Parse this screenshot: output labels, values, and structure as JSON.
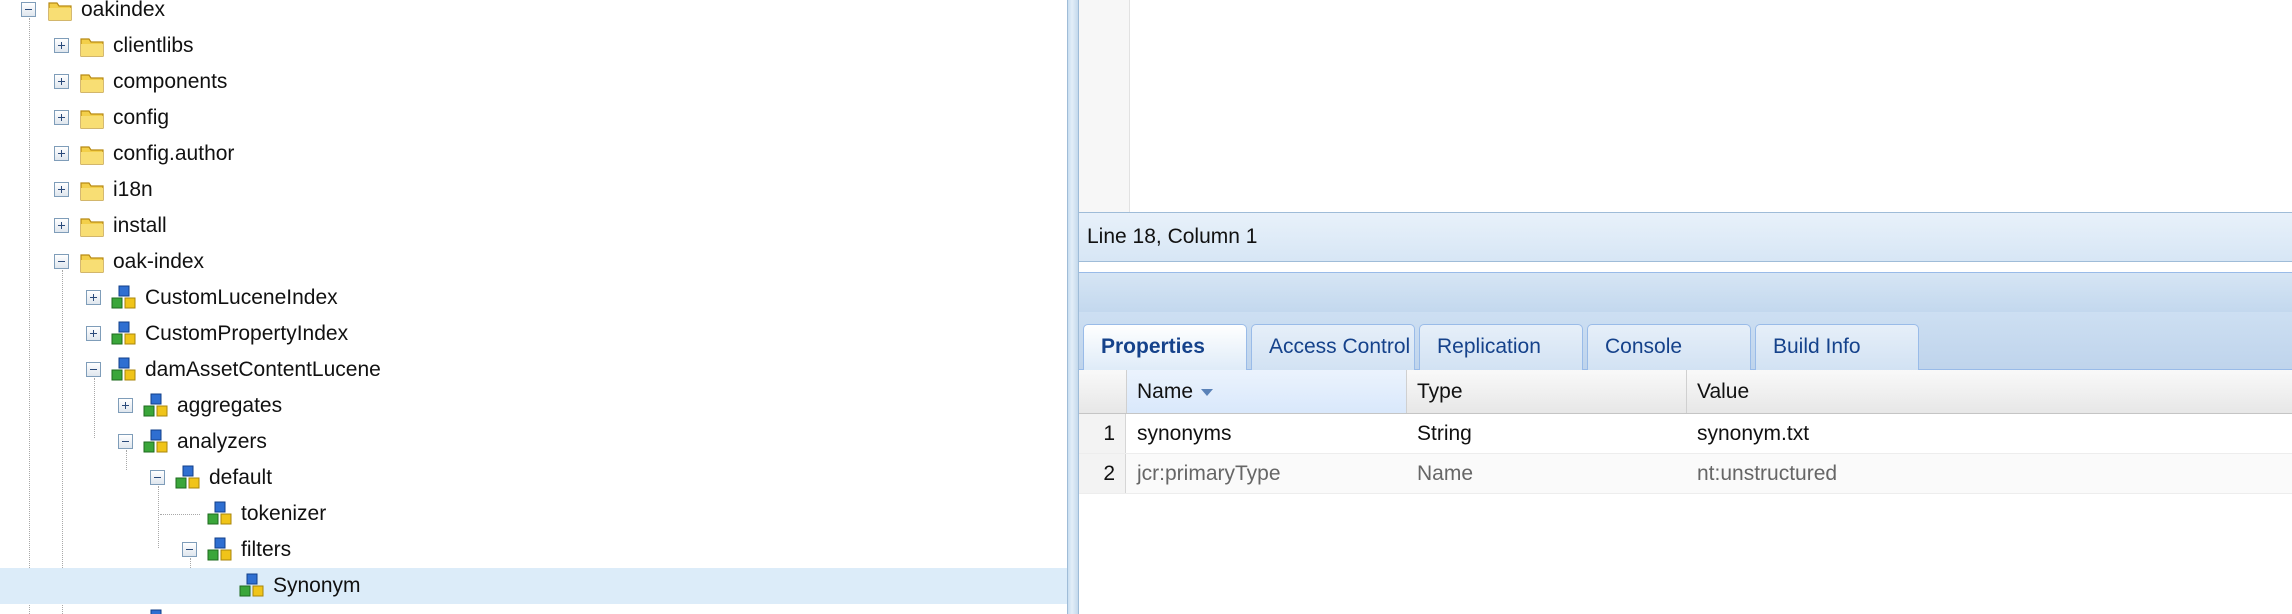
{
  "tree": {
    "nodes": [
      {
        "label": "oakindex",
        "type": "folder",
        "expanded": true,
        "depth": 0
      },
      {
        "label": "clientlibs",
        "type": "folder",
        "expanded": false,
        "depth": 1
      },
      {
        "label": "components",
        "type": "folder",
        "expanded": false,
        "depth": 1
      },
      {
        "label": "config",
        "type": "folder",
        "expanded": false,
        "depth": 1
      },
      {
        "label": "config.author",
        "type": "folder",
        "expanded": false,
        "depth": 1
      },
      {
        "label": "i18n",
        "type": "folder",
        "expanded": false,
        "depth": 1
      },
      {
        "label": "install",
        "type": "folder",
        "expanded": false,
        "depth": 1
      },
      {
        "label": "oak-index",
        "type": "folder",
        "expanded": true,
        "depth": 1
      },
      {
        "label": "CustomLuceneIndex",
        "type": "node",
        "expanded": false,
        "depth": 2
      },
      {
        "label": "CustomPropertyIndex",
        "type": "node",
        "expanded": false,
        "depth": 2
      },
      {
        "label": "damAssetContentLucene",
        "type": "node",
        "expanded": true,
        "depth": 2
      },
      {
        "label": "aggregates",
        "type": "node",
        "expanded": false,
        "depth": 3
      },
      {
        "label": "analyzers",
        "type": "node",
        "expanded": true,
        "depth": 3
      },
      {
        "label": "default",
        "type": "node",
        "expanded": true,
        "depth": 4
      },
      {
        "label": "tokenizer",
        "type": "node",
        "expanded": null,
        "depth": 5
      },
      {
        "label": "filters",
        "type": "node",
        "expanded": true,
        "depth": 5
      },
      {
        "label": "Synonym",
        "type": "node",
        "expanded": null,
        "depth": 6,
        "selected": true
      }
    ]
  },
  "editor": {
    "status": "Line 18, Column 1"
  },
  "tabs": [
    {
      "label": "Properties",
      "active": true
    },
    {
      "label": "Access Control",
      "active": false
    },
    {
      "label": "Replication",
      "active": false
    },
    {
      "label": "Console",
      "active": false
    },
    {
      "label": "Build Info",
      "active": false
    }
  ],
  "properties": {
    "columns": [
      "Name",
      "Type",
      "Value"
    ],
    "sorted_column": "Name",
    "rows": [
      {
        "num": "1",
        "name": "synonyms",
        "type": "String",
        "value": "synonym.txt",
        "protected": false
      },
      {
        "num": "2",
        "name": "jcr:primaryType",
        "type": "Name",
        "value": "nt:unstructured",
        "protected": true
      }
    ]
  },
  "colors": {
    "selection": "#dcecf9",
    "tab_text": "#15428b",
    "panel_blue": "#c3d8ee"
  }
}
